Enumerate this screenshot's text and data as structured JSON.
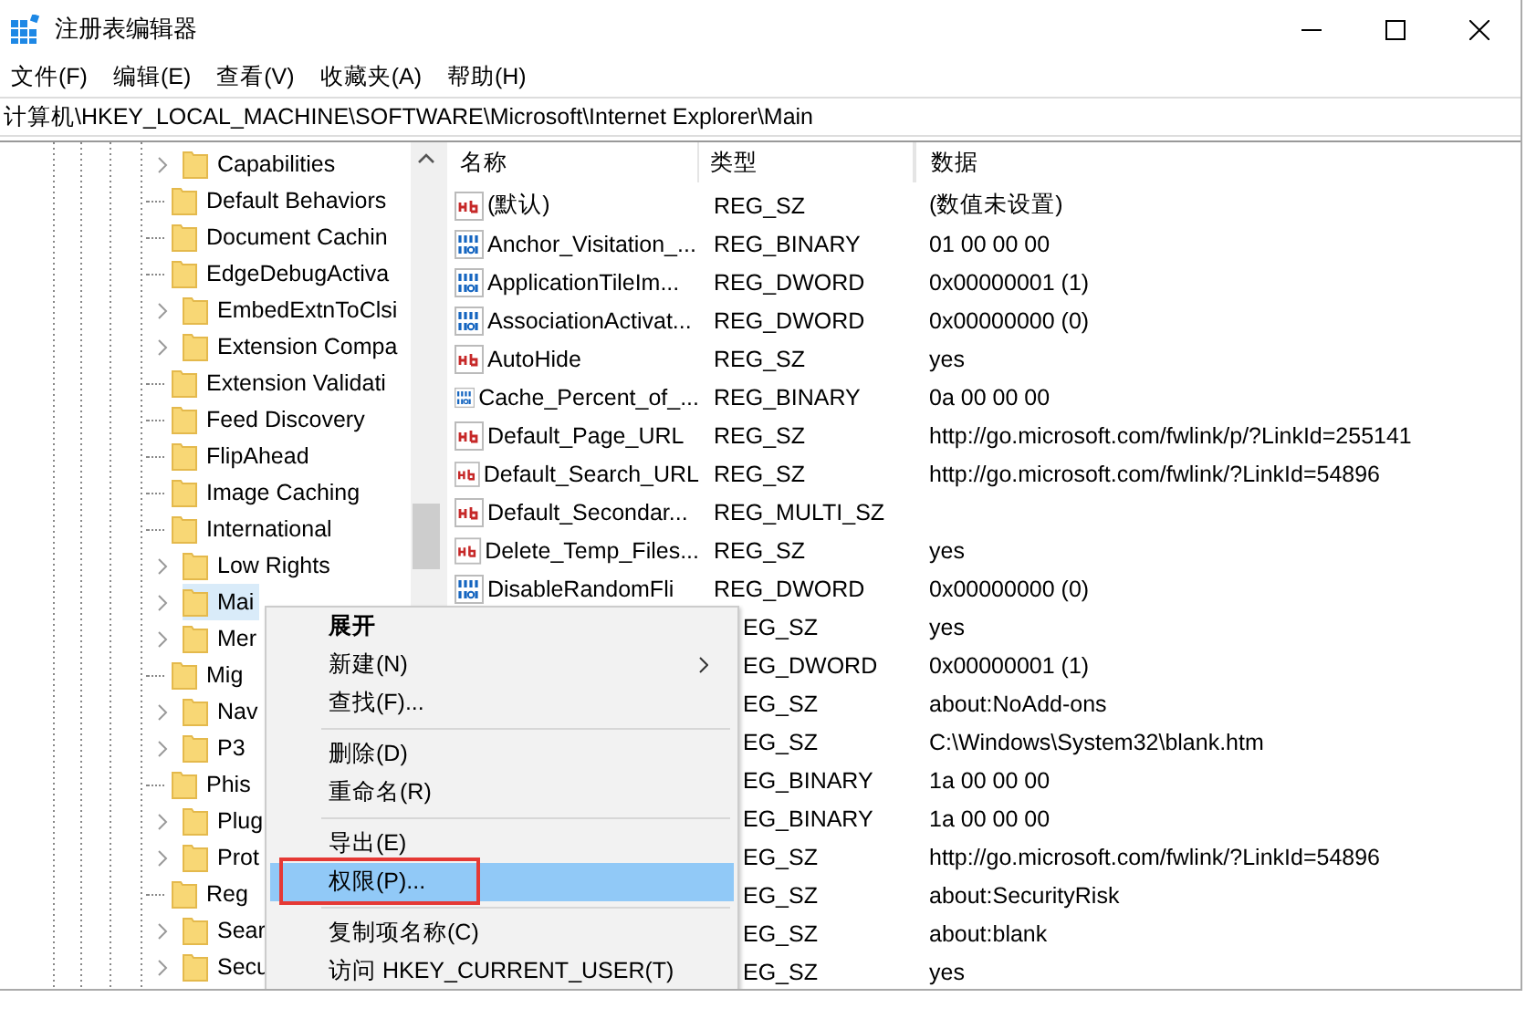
{
  "window": {
    "title": "注册表编辑器"
  },
  "menu": [
    "文件(F)",
    "编辑(E)",
    "查看(V)",
    "收藏夹(A)",
    "帮助(H)"
  ],
  "address": "计算机\\HKEY_LOCAL_MACHINE\\SOFTWARE\\Microsoft\\Internet Explorer\\Main",
  "tree": [
    {
      "label": "Capabilities",
      "expandable": true,
      "selected": false
    },
    {
      "label": "Default Behaviors",
      "expandable": false,
      "selected": false
    },
    {
      "label": "Document Cachin",
      "expandable": false,
      "selected": false
    },
    {
      "label": "EdgeDebugActiva",
      "expandable": false,
      "selected": false
    },
    {
      "label": "EmbedExtnToClsi",
      "expandable": true,
      "selected": false
    },
    {
      "label": "Extension Compa",
      "expandable": true,
      "selected": false
    },
    {
      "label": "Extension Validati",
      "expandable": false,
      "selected": false
    },
    {
      "label": "Feed Discovery",
      "expandable": false,
      "selected": false
    },
    {
      "label": "FlipAhead",
      "expandable": false,
      "selected": false
    },
    {
      "label": "Image Caching",
      "expandable": false,
      "selected": false
    },
    {
      "label": "International",
      "expandable": false,
      "selected": false
    },
    {
      "label": "Low Rights",
      "expandable": true,
      "selected": false
    },
    {
      "label": "Mai",
      "expandable": true,
      "selected": true
    },
    {
      "label": "Mer",
      "expandable": true,
      "selected": false
    },
    {
      "label": "Mig",
      "expandable": false,
      "selected": false
    },
    {
      "label": "Nav",
      "expandable": true,
      "selected": false
    },
    {
      "label": "P3",
      "expandable": true,
      "selected": false
    },
    {
      "label": "Phis",
      "expandable": false,
      "selected": false
    },
    {
      "label": "Plug",
      "expandable": true,
      "selected": false
    },
    {
      "label": "Prot",
      "expandable": true,
      "selected": false
    },
    {
      "label": "Reg",
      "expandable": false,
      "selected": false
    },
    {
      "label": "Sear",
      "expandable": true,
      "selected": false
    },
    {
      "label": "Secu",
      "expandable": true,
      "selected": false
    }
  ],
  "values": {
    "columns": [
      "名称",
      "类型",
      "数据"
    ],
    "rows": [
      {
        "kind": "string",
        "name": "(默认)",
        "type": "REG_SZ",
        "data": "(数值未设置)"
      },
      {
        "kind": "binary",
        "name": "Anchor_Visitation_...",
        "type": "REG_BINARY",
        "data": "01 00 00 00"
      },
      {
        "kind": "binary",
        "name": "ApplicationTileIm...",
        "type": "REG_DWORD",
        "data": "0x00000001 (1)"
      },
      {
        "kind": "binary",
        "name": "AssociationActivat...",
        "type": "REG_DWORD",
        "data": "0x00000000 (0)"
      },
      {
        "kind": "string",
        "name": "AutoHide",
        "type": "REG_SZ",
        "data": "yes"
      },
      {
        "kind": "binary",
        "name": "Cache_Percent_of_...",
        "type": "REG_BINARY",
        "data": "0a 00 00 00"
      },
      {
        "kind": "string",
        "name": "Default_Page_URL",
        "type": "REG_SZ",
        "data": "http://go.microsoft.com/fwlink/p/?LinkId=255141"
      },
      {
        "kind": "string",
        "name": "Default_Search_URL",
        "type": "REG_SZ",
        "data": "http://go.microsoft.com/fwlink/?LinkId=54896"
      },
      {
        "kind": "string",
        "name": "Default_Secondar...",
        "type": "REG_MULTI_SZ"
      },
      {
        "kind": "string",
        "name": "Delete_Temp_Files...",
        "type": "REG_SZ",
        "data": "yes"
      },
      {
        "kind": "binary",
        "name": "DisableRandomFli",
        "type": "REG_DWORD",
        "data": "0x00000000 (0)"
      },
      {
        "kind": "covered",
        "type": "EG_SZ",
        "data": "yes"
      },
      {
        "kind": "covered",
        "type": "EG_DWORD",
        "data": "0x00000001 (1)"
      },
      {
        "kind": "covered",
        "type": "EG_SZ",
        "data": "about:NoAdd-ons"
      },
      {
        "kind": "covered",
        "type": "EG_SZ",
        "data": "C:\\Windows\\System32\\blank.htm"
      },
      {
        "kind": "covered",
        "type": "EG_BINARY",
        "data": "1a 00 00 00"
      },
      {
        "kind": "covered",
        "type": "EG_BINARY",
        "data": "1a 00 00 00"
      },
      {
        "kind": "covered",
        "type": "EG_SZ",
        "data": "http://go.microsoft.com/fwlink/?LinkId=54896"
      },
      {
        "kind": "covered",
        "type": "EG_SZ",
        "data": "about:SecurityRisk"
      },
      {
        "kind": "covered",
        "type": "EG_SZ",
        "data": "about:blank"
      },
      {
        "kind": "covered",
        "type": "EG_SZ",
        "data": "yes"
      }
    ]
  },
  "context_menu": [
    {
      "kind": "item",
      "label": "展开",
      "bold": true,
      "submenu": false,
      "selected": false,
      "outlined": false
    },
    {
      "kind": "item",
      "label": "新建(N)",
      "bold": false,
      "submenu": true,
      "selected": false,
      "outlined": false
    },
    {
      "kind": "item",
      "label": "查找(F)...",
      "bold": false,
      "submenu": false,
      "selected": false,
      "outlined": false
    },
    {
      "kind": "separator"
    },
    {
      "kind": "item",
      "label": "删除(D)",
      "bold": false,
      "submenu": false,
      "selected": false,
      "outlined": false
    },
    {
      "kind": "item",
      "label": "重命名(R)",
      "bold": false,
      "submenu": false,
      "selected": false,
      "outlined": false
    },
    {
      "kind": "separator"
    },
    {
      "kind": "item",
      "label": "导出(E)",
      "bold": false,
      "submenu": false,
      "selected": false,
      "outlined": false
    },
    {
      "kind": "item",
      "label": "权限(P)...",
      "bold": false,
      "submenu": false,
      "selected": true,
      "outlined": true
    },
    {
      "kind": "separator"
    },
    {
      "kind": "item",
      "label": "复制项名称(C)",
      "bold": false,
      "submenu": false,
      "selected": false,
      "outlined": false
    },
    {
      "kind": "item",
      "label": "访问 HKEY_CURRENT_USER(T)",
      "bold": false,
      "submenu": false,
      "selected": false,
      "outlined": false
    }
  ]
}
